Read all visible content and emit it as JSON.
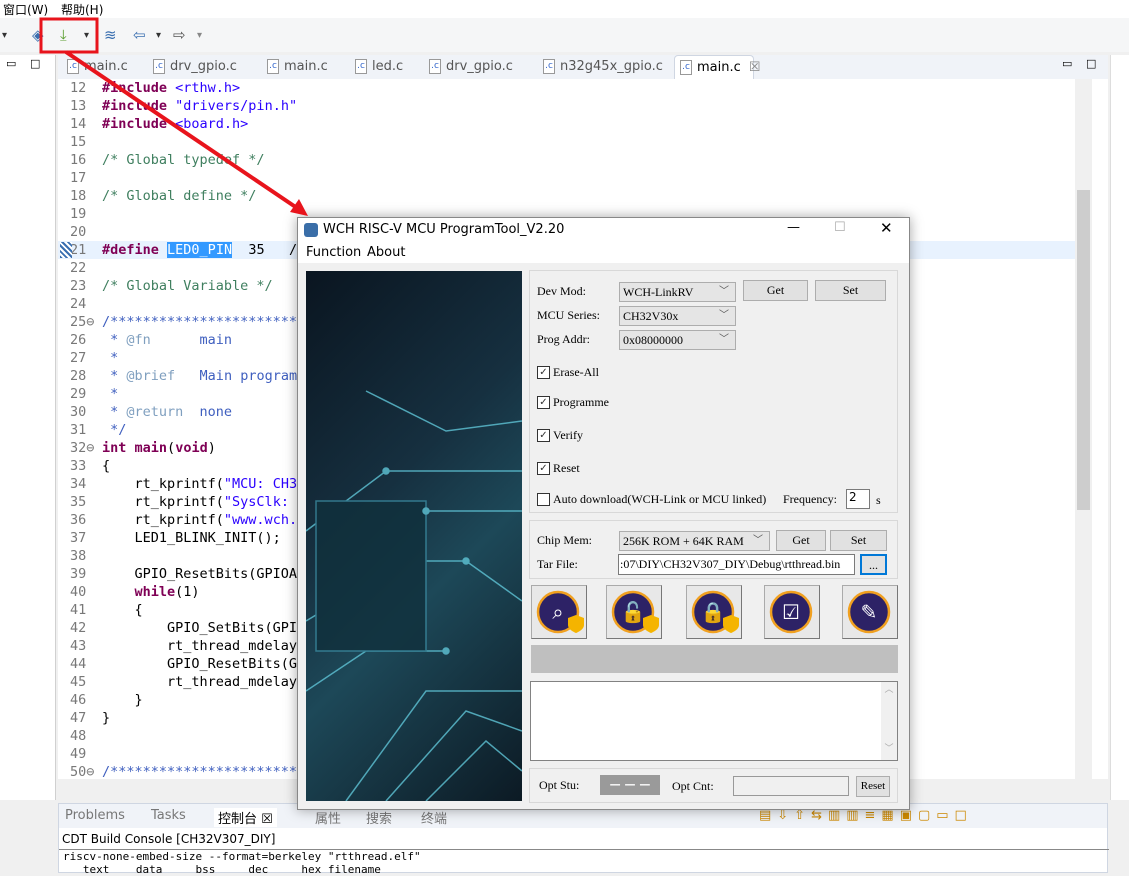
{
  "menubar": {
    "items": [
      "窗口(W)",
      "帮助(H)"
    ]
  },
  "toolbar": {
    "icons": [
      "build-icon",
      "debug-icon",
      "download-icon",
      "layers-icon",
      "back-arrow-icon",
      "forward-arrow-icon"
    ]
  },
  "editor_tabs": [
    {
      "label": "main.c"
    },
    {
      "label": "drv_gpio.c"
    },
    {
      "label": "main.c"
    },
    {
      "label": "led.c"
    },
    {
      "label": "drv_gpio.c"
    },
    {
      "label": "n32g45x_gpio.c"
    },
    {
      "label": "main.c",
      "active": true,
      "close": "☒"
    }
  ],
  "code": [
    {
      "n": "12",
      "seg": [
        [
          "#include",
          "kw"
        ],
        [
          " <rthw.h>",
          "str"
        ]
      ]
    },
    {
      "n": "13",
      "seg": [
        [
          "#include",
          "kw"
        ],
        [
          " \"drivers/pin.h\"",
          "str"
        ]
      ]
    },
    {
      "n": "14",
      "seg": [
        [
          "#include",
          "kw"
        ],
        [
          " <board.h>",
          "str"
        ]
      ]
    },
    {
      "n": "15",
      "seg": []
    },
    {
      "n": "16",
      "seg": [
        [
          "/* Global typedef */",
          "cm"
        ]
      ]
    },
    {
      "n": "17",
      "seg": []
    },
    {
      "n": "18",
      "seg": [
        [
          "/* Global define */",
          "cm"
        ]
      ]
    },
    {
      "n": "19",
      "seg": []
    },
    {
      "n": "20",
      "seg": []
    },
    {
      "n": "21",
      "cur": true,
      "seg": [
        [
          "#define",
          "kw"
        ],
        [
          " ",
          ""
        ],
        [
          "LED0_PIN",
          "sel"
        ],
        [
          "  35   /",
          ""
        ]
      ]
    },
    {
      "n": "22",
      "seg": []
    },
    {
      "n": "23",
      "seg": [
        [
          "/* Global Variable */",
          "cm"
        ]
      ]
    },
    {
      "n": "24",
      "seg": []
    },
    {
      "n": "25⊖",
      "seg": [
        [
          "/*************************",
          "doc"
        ]
      ]
    },
    {
      "n": "26",
      "seg": [
        [
          " * ",
          "doc"
        ],
        [
          "@fn",
          "tag"
        ],
        [
          "      main",
          "doc"
        ]
      ]
    },
    {
      "n": "27",
      "seg": [
        [
          " *",
          "doc"
        ]
      ]
    },
    {
      "n": "28",
      "seg": [
        [
          " * ",
          "doc"
        ],
        [
          "@brief",
          "tag"
        ],
        [
          "   Main program.",
          "doc"
        ]
      ]
    },
    {
      "n": "29",
      "seg": [
        [
          " *",
          "doc"
        ]
      ]
    },
    {
      "n": "30",
      "seg": [
        [
          " * ",
          "doc"
        ],
        [
          "@return",
          "tag"
        ],
        [
          "  none",
          "doc"
        ]
      ]
    },
    {
      "n": "31",
      "seg": [
        [
          " */",
          "doc"
        ]
      ]
    },
    {
      "n": "32⊖",
      "seg": [
        [
          "int",
          "kw"
        ],
        [
          " ",
          ""
        ],
        [
          "main",
          "kw"
        ],
        [
          "(",
          ""
        ],
        [
          "void",
          "kw"
        ],
        [
          ")",
          ""
        ]
      ]
    },
    {
      "n": "33",
      "seg": [
        [
          "{",
          ""
        ]
      ]
    },
    {
      "n": "34",
      "seg": [
        [
          "    rt_kprintf(",
          ""
        ],
        [
          "\"MCU: CH32",
          "str"
        ]
      ]
    },
    {
      "n": "35",
      "seg": [
        [
          "    rt_kprintf(",
          ""
        ],
        [
          "\"SysClk: %",
          "str"
        ]
      ]
    },
    {
      "n": "36",
      "seg": [
        [
          "    rt_kprintf(",
          ""
        ],
        [
          "\"www.wch.c",
          "str"
        ]
      ]
    },
    {
      "n": "37",
      "seg": [
        [
          "    LED1_BLINK_INIT();",
          ""
        ]
      ]
    },
    {
      "n": "38",
      "seg": []
    },
    {
      "n": "39",
      "seg": [
        [
          "    GPIO_ResetBits(GPIOA,",
          ""
        ]
      ]
    },
    {
      "n": "40",
      "seg": [
        [
          "    ",
          ""
        ],
        [
          "while",
          "kw"
        ],
        [
          "(1)",
          ""
        ]
      ]
    },
    {
      "n": "41",
      "seg": [
        [
          "    {",
          ""
        ]
      ]
    },
    {
      "n": "42",
      "seg": [
        [
          "        GPIO_SetBits(GPIO",
          ""
        ]
      ]
    },
    {
      "n": "43",
      "seg": [
        [
          "        rt_thread_mdelay(",
          ""
        ]
      ]
    },
    {
      "n": "44",
      "seg": [
        [
          "        GPIO_ResetBits(GP",
          ""
        ]
      ]
    },
    {
      "n": "45",
      "seg": [
        [
          "        rt_thread_mdelay(",
          ""
        ]
      ]
    },
    {
      "n": "46",
      "seg": [
        [
          "    }",
          ""
        ]
      ]
    },
    {
      "n": "47",
      "seg": [
        [
          "}",
          ""
        ]
      ]
    },
    {
      "n": "48",
      "seg": []
    },
    {
      "n": "49",
      "seg": []
    },
    {
      "n": "50⊖",
      "seg": [
        [
          "/*************************",
          "doc"
        ]
      ]
    }
  ],
  "bottom": {
    "tabs": [
      "Problems",
      "Tasks",
      "控制台 ☒",
      "属性",
      "搜索",
      "终端"
    ],
    "console_title": "CDT Build Console [CH32V307_DIY]",
    "lines": [
      "riscv-none-embed-size --format=berkeley \"rtthread.elf\"",
      "   text    data     bss     dec     hex filename"
    ]
  },
  "dialog": {
    "title": "WCH RISC-V MCU ProgramTool_V2.20",
    "menu": [
      "Function",
      "About"
    ],
    "dev_mod": {
      "label": "Dev Mod:",
      "value": "WCH-LinkRV"
    },
    "mcu_series": {
      "label": "MCU Series:",
      "value": "CH32V30x"
    },
    "prog_addr": {
      "label": "Prog Addr:",
      "value": "0x08000000"
    },
    "get": "Get",
    "set": "Set",
    "checks": [
      {
        "label": "Erase-All",
        "checked": true
      },
      {
        "label": "Programme",
        "checked": true
      },
      {
        "label": "Verify",
        "checked": true
      },
      {
        "label": "Reset",
        "checked": true
      }
    ],
    "auto": {
      "label": "Auto download(WCH-Link or MCU linked)",
      "checked": false,
      "freq_label": "Frequency:",
      "freq": "2",
      "unit": "s"
    },
    "chip_mem": {
      "label": "Chip Mem:",
      "value": "256K ROM +  64K RAM"
    },
    "tar_file": {
      "label": "Tar File:",
      "value": ":07\\DIY\\CH32V307_DIY\\Debug\\rtthread.bin",
      "browse": "..."
    },
    "action_icons": [
      "query-icon",
      "unprotect-icon",
      "protect-icon",
      "program-verify-icon",
      "erase-icon"
    ],
    "progress": 0,
    "opt_stu": {
      "label": "Opt Stu:",
      "value": "— — —"
    },
    "opt_cnt": {
      "label": "Opt Cnt:",
      "value": ""
    },
    "reset": "Reset"
  },
  "annotation_color": "#e8141c"
}
